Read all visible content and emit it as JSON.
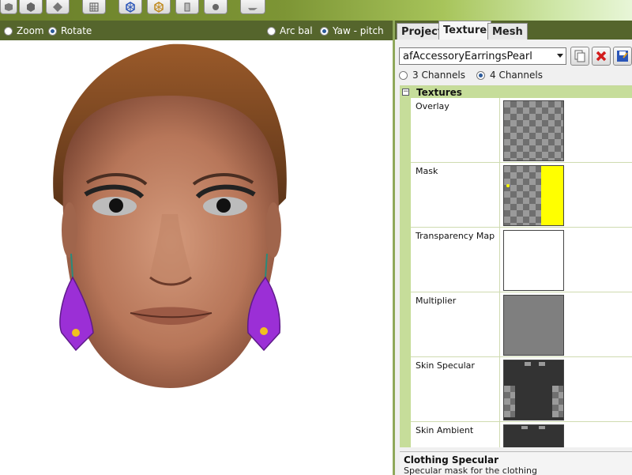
{
  "viewport": {
    "options": [
      {
        "label": "Zoom",
        "selected": false
      },
      {
        "label": "Rotate",
        "selected": true
      },
      {
        "label": "Arc bal",
        "selected": false
      },
      {
        "label": "Yaw - pitch",
        "selected": true
      }
    ]
  },
  "toolbar": {
    "buttons": [
      "cube-icon",
      "box-icon",
      "diamond-icon",
      "grid-icon",
      "mesh-blue-icon",
      "mesh-gold-icon",
      "page-icon",
      "circle-icon",
      "plane-icon"
    ]
  },
  "tabs": [
    {
      "label": "Project",
      "active": false
    },
    {
      "label": "Texture",
      "active": true
    },
    {
      "label": "Mesh",
      "active": false
    }
  ],
  "texture": {
    "selected_item": "afAccessoryEarringsPearl",
    "buttons": [
      "copy-icon",
      "delete-icon",
      "save-icon"
    ],
    "channels": [
      {
        "label": "3 Channels",
        "selected": false
      },
      {
        "label": "4 Channels",
        "selected": true
      }
    ],
    "category": "Textures",
    "properties": [
      {
        "name": "Overlay",
        "thumb": "checker"
      },
      {
        "name": "Mask",
        "thumb": "mask"
      },
      {
        "name": "Transparency Map",
        "thumb": "white"
      },
      {
        "name": "Multiplier",
        "thumb": "gray"
      },
      {
        "name": "Skin Specular",
        "thumb": "dark"
      },
      {
        "name": "Skin Ambient",
        "thumb": "dark"
      }
    ]
  },
  "description": {
    "title": "Clothing Specular",
    "text": "Specular mask for the clothing"
  },
  "colors": {
    "accent_green": "#55652c",
    "earring_purple": "#9b2fd6",
    "mask_yellow": "#ffff00"
  }
}
